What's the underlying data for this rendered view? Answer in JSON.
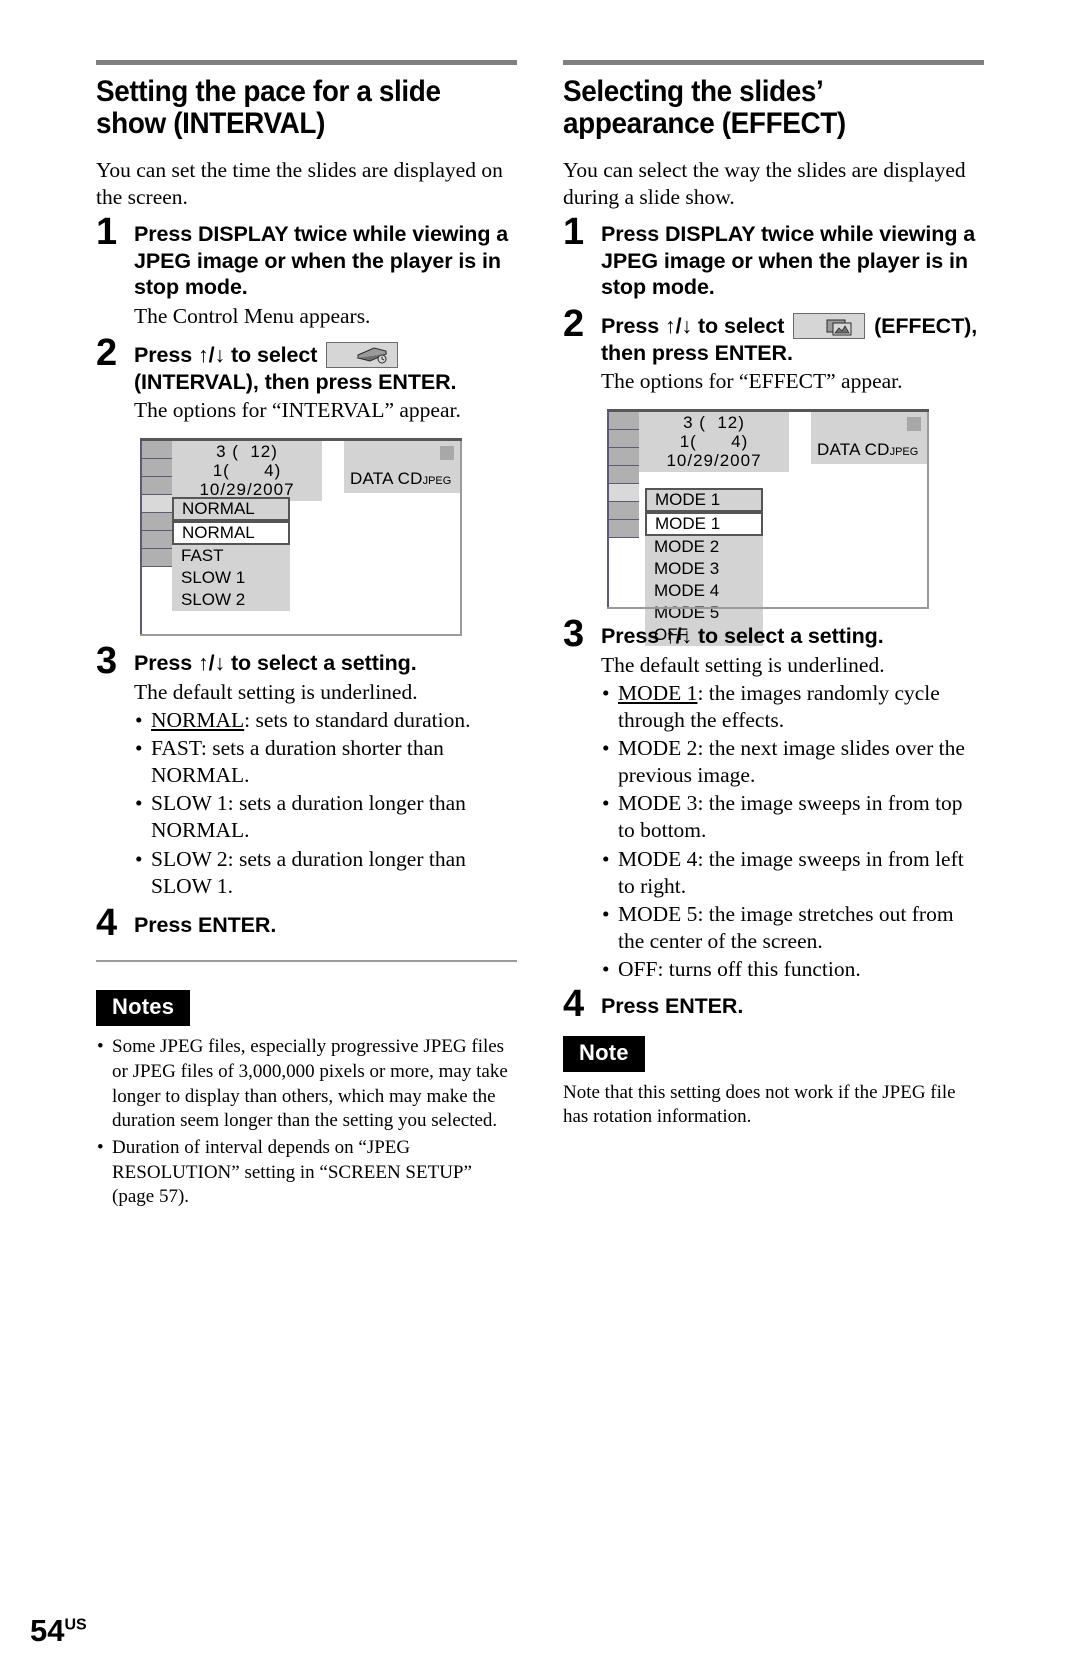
{
  "page": {
    "folio_number": "54",
    "folio_suffix": "US"
  },
  "left": {
    "heading": "Setting the pace for a slide show (INTERVAL)",
    "lead": "You can set the time the slides are displayed on the screen.",
    "steps": [
      {
        "num": "1",
        "title": "Press DISPLAY twice while viewing a JPEG image or when the player is in stop mode.",
        "sub": "The Control Menu appears."
      },
      {
        "num": "2",
        "title_before": "Press ↑/↓ to select",
        "title_after": "(INTERVAL), then press ENTER.",
        "icon": "interval-icon",
        "sub": "The options for “INTERVAL” appear."
      },
      {
        "num": "3",
        "title": "Press ↑/↓ to select a setting.",
        "sub": "The default setting is underlined."
      },
      {
        "num": "4",
        "title": "Press ENTER."
      }
    ],
    "screen": {
      "info_line1": "3 (  12)",
      "info_line2": "1(      4)",
      "info_line3": "10/29/2007",
      "current": "NORMAL",
      "options": [
        "NORMAL",
        "FAST",
        "SLOW 1",
        "SLOW 2"
      ],
      "badge_label": "DATA CD",
      "badge_sup": "JPEG"
    },
    "settings": [
      {
        "name": "NORMAL",
        "underlined": true,
        "desc": ": sets to standard duration."
      },
      {
        "name": "FAST",
        "underlined": false,
        "desc": ": sets a duration shorter than NORMAL."
      },
      {
        "name": "SLOW 1",
        "underlined": false,
        "desc": ": sets a duration longer than NORMAL."
      },
      {
        "name": "SLOW 2",
        "underlined": false,
        "desc": ": sets a duration longer than SLOW 1."
      }
    ],
    "notes_tag": "Notes",
    "notes": [
      "Some JPEG files, especially progressive JPEG files or JPEG files of 3,000,000 pixels or more, may take longer to display than others, which may make the duration seem longer than the setting you selected.",
      "Duration of interval depends on “JPEG RESOLUTION” setting in “SCREEN SETUP” (page 57)."
    ]
  },
  "right": {
    "heading": "Selecting the slides’ appearance (EFFECT)",
    "lead": "You can select the way the slides are displayed during a slide show.",
    "steps": [
      {
        "num": "1",
        "title": "Press DISPLAY twice while viewing a JPEG image or when the player is in stop mode."
      },
      {
        "num": "2",
        "title_before": "Press ↑/↓ to select",
        "title_after": "(EFFECT), then press ENTER.",
        "icon": "effect-icon",
        "sub": "The options for “EFFECT” appear."
      },
      {
        "num": "3",
        "title": "Press ↑/↓ to select a setting.",
        "sub": "The default setting is underlined."
      },
      {
        "num": "4",
        "title": "Press ENTER."
      }
    ],
    "screen": {
      "info_line1": "3 (  12)",
      "info_line2": "1(      4)",
      "info_line3": "10/29/2007",
      "current": "MODE 1",
      "options": [
        "MODE 1",
        "MODE 2",
        "MODE 3",
        "MODE 4",
        "MODE 5",
        "OFF"
      ],
      "badge_label": "DATA CD",
      "badge_sup": "JPEG"
    },
    "settings": [
      {
        "name": "MODE 1",
        "underlined": true,
        "desc": ": the images randomly cycle through the effects."
      },
      {
        "name": "MODE 2",
        "underlined": false,
        "desc": ": the next image slides over the previous image."
      },
      {
        "name": "MODE 3",
        "underlined": false,
        "desc": ": the image sweeps in from top to bottom."
      },
      {
        "name": "MODE 4",
        "underlined": false,
        "desc": ": the image sweeps in from left to right."
      },
      {
        "name": "MODE 5",
        "underlined": false,
        "desc": ": the image stretches out from the center of the screen."
      },
      {
        "name": "OFF",
        "underlined": false,
        "desc": ": turns off this function."
      }
    ],
    "note_tag": "Note",
    "note_body": "Note that this setting does not work if the JPEG file has rotation information."
  }
}
